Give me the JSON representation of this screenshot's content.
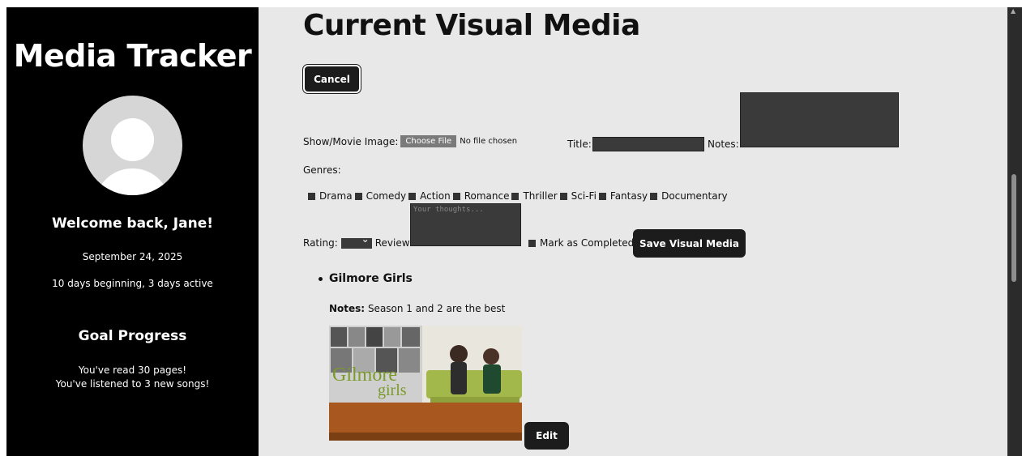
{
  "sidebar": {
    "app_title": "Media Tracker",
    "welcome": "Welcome back, Jane!",
    "date": "September 24, 2025",
    "streak": "10 days beginning, 3 days active",
    "goal_title": "Goal Progress",
    "goals": [
      "You've read 30 pages!",
      "You've listened to 3 new songs!"
    ]
  },
  "main": {
    "page_title": "Current Visual Media",
    "cancel_label": "Cancel",
    "image_label": "Show/Movie Image:",
    "choose_file_label": "Choose File",
    "no_file_text": "No file chosen",
    "title_label": "Title:",
    "notes_label": "Notes:",
    "genres_label": "Genres:",
    "genres": [
      "Drama",
      "Comedy",
      "Action",
      "Romance",
      "Thriller",
      "Sci-Fi",
      "Fantasy",
      "Documentary"
    ],
    "rating_label": "Rating:",
    "review_label": "Review:",
    "review_placeholder": "Your thoughts...",
    "mark_completed_label": "Mark as Completed",
    "save_label": "Save Visual Media",
    "media_item": {
      "title": "Gilmore Girls",
      "notes_label": "Notes:",
      "notes_text": "Season 1 and 2 are the best",
      "poster_text_line1": "Gilmore",
      "poster_text_line2": "girls"
    },
    "edit_label": "Edit"
  },
  "colors": {
    "sidebar_bg": "#000000",
    "main_bg": "#e8e8e8",
    "button_bg": "#1c1c1c",
    "input_bg": "#3a3a3a"
  }
}
